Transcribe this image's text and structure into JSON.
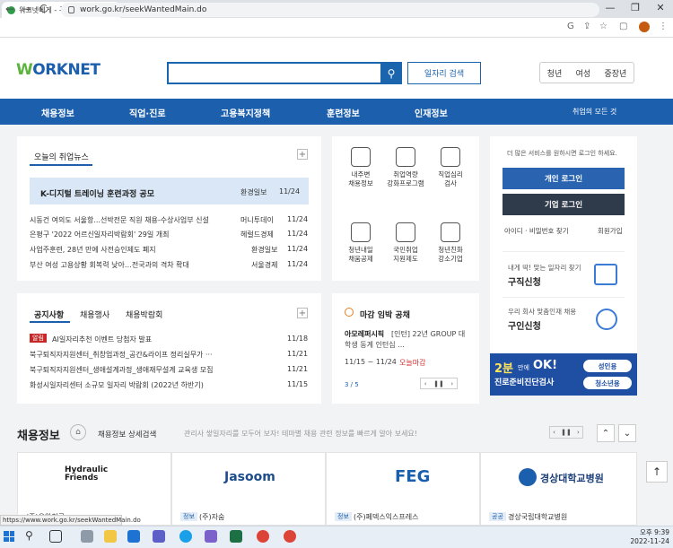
{
  "browser": {
    "tab_title": "워크넷에게 - 구인/구직",
    "tab_close": "×",
    "new_tab": "+",
    "url": "work.go.kr/seekWantedMain.do",
    "status_url": "https://www.work.go.kr/seekWantedMain.do",
    "nav_back": "←",
    "nav_forward": "→",
    "nav_reload": "C",
    "win_min": "—",
    "win_max": "❐",
    "win_close": "✕",
    "omni_icons": [
      "G",
      "⇪",
      "☆",
      "▢",
      "⋮"
    ]
  },
  "header": {
    "logo_w": "W",
    "logo_rest": "ORKNET",
    "search_placeholder": "",
    "job_search_button": "일자리 검색",
    "segments": [
      "청년",
      "여성",
      "중장년"
    ]
  },
  "gnb": {
    "items": [
      "채용정보",
      "직업·진로",
      "고용복지정책",
      "훈련정보",
      "인재정보"
    ],
    "all_jobs": "취업의 모든 것"
  },
  "news": {
    "title": "오늘의 취업뉴스",
    "featured": {
      "title": "K-디지털 트레이닝 훈련과정 공모",
      "source": "환경일보",
      "date": "11/24"
    },
    "items": [
      {
        "title": "시동건 여의도 서울항...선박전문 직원 채용-수상사업부 신설",
        "source": "머니투데이",
        "date": "11/24"
      },
      {
        "title": "은평구 '2022 어르신일자리박람회' 29일 개최",
        "source": "헤럴드경제",
        "date": "11/24"
      },
      {
        "title": "사업주훈련, 28년 만에 사전승인제도 폐지",
        "source": "환경일보",
        "date": "11/24"
      },
      {
        "title": "부산 여성 고용상황 회복력 낮아…전국과의 격차 확대",
        "source": "서울경제",
        "date": "11/24"
      }
    ]
  },
  "services": [
    {
      "label1": "내주변",
      "label2": "채용정보"
    },
    {
      "label1": "취업역량",
      "label2": "강화프로그램"
    },
    {
      "label1": "직업심리",
      "label2": "검사"
    },
    {
      "label1": "청년내일",
      "label2": "채움공제"
    },
    {
      "label1": "국민취업",
      "label2": "지원제도"
    },
    {
      "label1": "청년친화",
      "label2": "강소기업"
    }
  ],
  "login": {
    "prompt": "더 많은 서비스를 원하시면 로그인 하세요.",
    "personal": "개인 로그인",
    "company": "기업 로그인",
    "find": "아이디 · 비밀번호 찾기",
    "join": "회원가입",
    "seek_desc": "내게 딱! 맞는 일자리 찾기",
    "seek_title": "구직신청",
    "hire_desc": "우리 회사 맞춤인재 채용",
    "hire_title": "구인신청"
  },
  "notices": {
    "tabs": [
      "공지사항",
      "채용행사",
      "채용박람회"
    ],
    "items": [
      {
        "badge": "알림",
        "title": "AI일자리추천 이벤트 당첨자 발표",
        "date": "11/18"
      },
      {
        "badge": "",
        "title": "북구퇴직자지원센터_취창업과정_공간&라이프 정리실무가 ···",
        "date": "11/21"
      },
      {
        "badge": "",
        "title": "북구퇴직자지원센터_생애설계과정_생애재무설계 교육생 모집",
        "date": "11/21"
      },
      {
        "badge": "",
        "title": "화성시일자리센터 소규모 일자리 박람회 (2022년 하반기)",
        "date": "11/15"
      }
    ]
  },
  "deadline": {
    "title": "마감 임박 공채",
    "company": "아모레퍼시픽",
    "desc": "[인턴] 22년 GROUP 대학생 동계 인턴십 ...",
    "period": "11/15 ~ 11/24",
    "today": "오늘마감",
    "pager": "3 / 5"
  },
  "banner": {
    "main": "2분",
    "main2": "만에",
    "ok": "OK!",
    "sub": "진로준비진단검사",
    "btn1": "성인용",
    "btn2": "청소년용"
  },
  "jobinfo": {
    "title": "채용정보",
    "detail": "채용정보 상세검색",
    "ticker": "관리사 쌓일자리를 모두어 보자! 테마별 채용 관련 정보를 빠르게 알아 보세요!"
  },
  "partners": [
    {
      "name": "Hydraulic Friends",
      "tag": "",
      "company": "(주)유압친구"
    },
    {
      "name": "Jasoom",
      "tag": "정보",
      "company": "(주)자숨"
    },
    {
      "name": "FEG",
      "tag": "정보",
      "company": "(주)페덱스익스프레스"
    },
    {
      "name": "경상대학교병원",
      "tag": "공공",
      "company": "경상국립대학교병원"
    }
  ],
  "taskbar": {
    "time": "오후 9:39",
    "date": "2022-11-24"
  }
}
